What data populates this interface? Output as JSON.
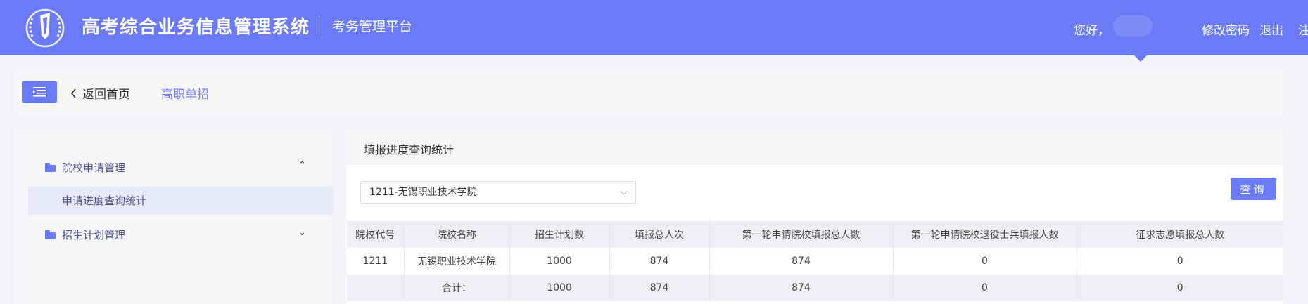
{
  "header": {
    "title": "高考综合业务信息管理系统",
    "subtitle": "考务管理平台",
    "greeting": "您好，",
    "links": {
      "change_password": "修改密码",
      "exit": "退出",
      "logout": "注销"
    },
    "accent_color": "#6b7bf7"
  },
  "breadcrumb": {
    "back_label": "返回首页",
    "current": "高职单招"
  },
  "sidebar": {
    "groups": [
      {
        "label": "院校申请管理",
        "expanded": true,
        "icon": "folder-icon"
      },
      {
        "label": "招生计划管理",
        "expanded": false,
        "icon": "folder-icon"
      }
    ],
    "active_sub": "申请进度查询统计"
  },
  "main": {
    "panel_title": "填报进度查询统计",
    "select_value": "1211-无锡职业技术学院",
    "query_label": "查询",
    "table": {
      "columns": [
        "院校代号",
        "院校名称",
        "招生计划数",
        "填报总人次",
        "第一轮申请院校填报总人数",
        "第一轮申请院校退役士兵填报人数",
        "征求志愿填报总人数"
      ],
      "rows": [
        [
          "1211",
          "无锡职业技术学院",
          "1000",
          "874",
          "874",
          "0",
          "0"
        ]
      ],
      "total": [
        "",
        "合计：",
        "1000",
        "874",
        "874",
        "0",
        "0"
      ]
    }
  }
}
